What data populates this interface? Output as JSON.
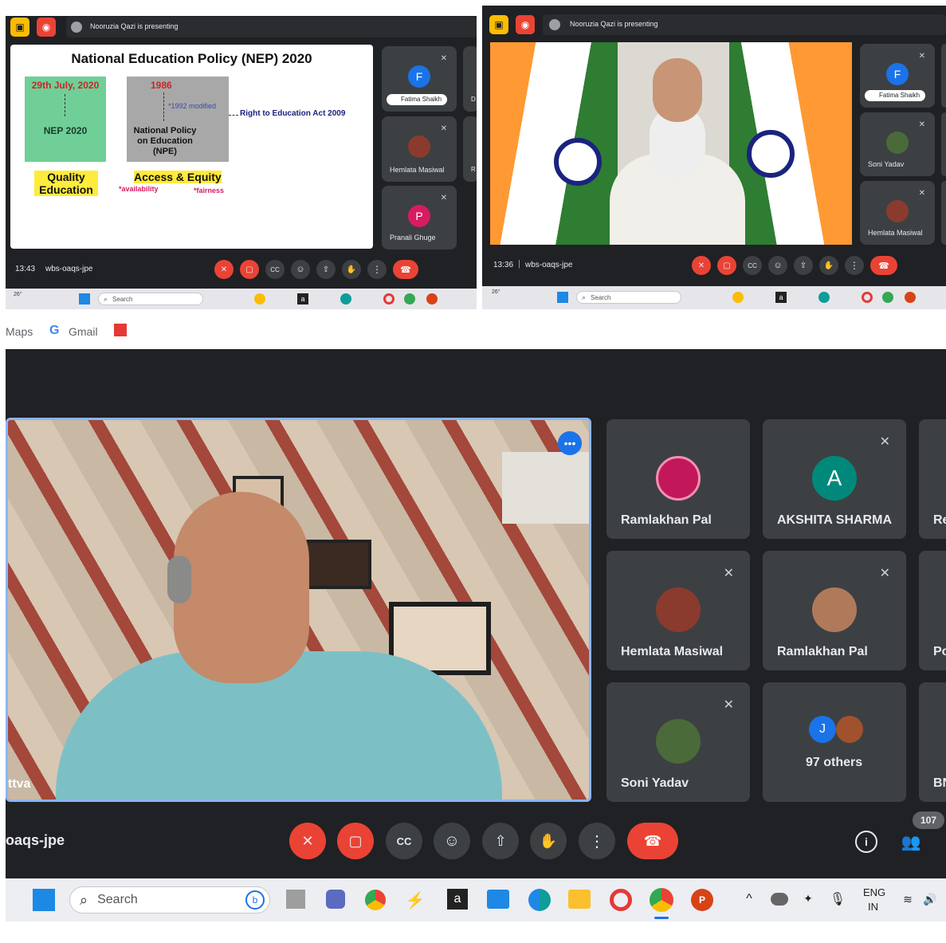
{
  "panels": {
    "top_left": {
      "presenting_text": "Nooruzia Qazi is presenting",
      "time": "13:43",
      "meeting_code": "wbs-oaqs-jpe",
      "slide": {
        "title": "National Education Policy (NEP) 2020",
        "green_date": "29th July, 2020",
        "green_label": "NEP 2020",
        "grey_year": "1986",
        "grey_modified": "*1992 modified",
        "grey_label": "National Policy on Education (NPE)",
        "rte": "Right to Education Act 2009",
        "quality": "Quality Education",
        "access": "Access & Equity",
        "availability": "*availability",
        "fairness": "*fairness"
      },
      "tiles": [
        {
          "initial": "F",
          "name": "Fatima Shaikh",
          "color": "#1a73e8"
        },
        {
          "initial": "",
          "name": "Hemlata Masiwal",
          "color": "#8a3b2e"
        },
        {
          "initial": "P",
          "name": "Pranali Ghuge",
          "color": "#d81b60"
        }
      ],
      "side_letters": [
        "D",
        "R"
      ],
      "search_placeholder": "Search",
      "weather": "26°"
    },
    "top_right": {
      "presenting_text": "Nooruzia Qazi is presenting",
      "time": "13:36",
      "meeting_code": "wbs-oaqs-jpe",
      "tiles": [
        {
          "initial": "F",
          "name": "Fatima Shaikh",
          "color": "#1a73e8"
        },
        {
          "initial": "",
          "name": "Soni Yadav",
          "color": "#4a6a3a"
        },
        {
          "initial": "",
          "name": "Hemlata Masiwal",
          "color": "#8a3b2e"
        }
      ],
      "search_placeholder": "Search",
      "weather": "26°"
    },
    "bottom": {
      "bookmarks": [
        "Maps",
        "Gmail"
      ],
      "speaker_label": "ttva",
      "meeting_code": "oaqs-jpe",
      "participant_count": "107",
      "tiles": [
        {
          "name": "Ramlakhan Pal",
          "initial": "",
          "color": "#c2185b"
        },
        {
          "name": "AKSHITA SHARMA",
          "initial": "A",
          "color": "#00897b"
        },
        {
          "name": "Re",
          "initial": "",
          "color": ""
        },
        {
          "name": "Hemlata Masiwal",
          "initial": "",
          "color": "#8a3b2e"
        },
        {
          "name": "Ramlakhan Pal",
          "initial": "",
          "color": "#b07a5a"
        },
        {
          "name": "Po",
          "initial": "",
          "color": ""
        },
        {
          "name": "Soni Yadav",
          "initial": "",
          "color": "#4a6a3a"
        },
        {
          "name": "97 others",
          "initial": "J",
          "color": "#1a73e8"
        },
        {
          "name": "BN",
          "initial": "",
          "color": ""
        }
      ],
      "search_placeholder": "Search",
      "lang_top": "ENG",
      "lang_bottom": "IN"
    }
  },
  "colors": {
    "meet_bg": "#202124",
    "tile_bg": "#3c4043",
    "danger": "#ea4335",
    "accent": "#1a73e8"
  }
}
